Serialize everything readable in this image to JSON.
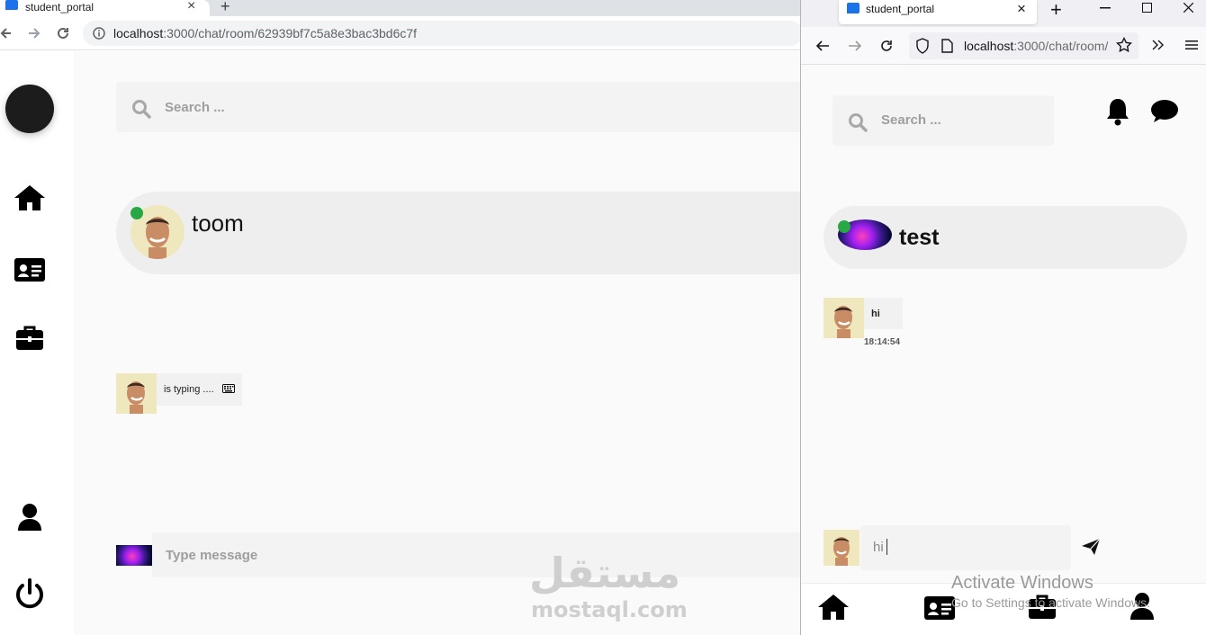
{
  "left_browser": {
    "tab_title": "student_portal",
    "tab_close": "×",
    "new_tab": "+",
    "url_host": "localhost",
    "url_path": ":3000/chat/room/62939bf7c5a8e3bac3bd6c7f"
  },
  "left_app": {
    "search_placeholder": "Search ...",
    "chat_contact_name": "toom",
    "typing_text": "is typing ....",
    "message_placeholder": "Type message"
  },
  "right_browser": {
    "tab_title": "student_portal",
    "tab_close": "×",
    "new_tab": "+",
    "url_host": "localhost",
    "url_path": ":3000/chat/room/"
  },
  "right_app": {
    "search_placeholder": "Search ...",
    "chat_contact_name": "test",
    "message_text": "hi",
    "message_time": "18:14:54",
    "message_input_value": "hi"
  },
  "overlays": {
    "watermark_arabic": "مستقل",
    "watermark_latin": "mostaql.com",
    "activate_title": "Activate Windows",
    "activate_subtitle": "Go to Settings to activate Windows."
  },
  "colors": {
    "online": "#27a845",
    "accent_tab_icon": "#1a73e8"
  },
  "icons": [
    "home-icon",
    "id-card-icon",
    "briefcase-icon",
    "user-icon",
    "power-icon",
    "search-icon",
    "bell-icon",
    "chat-bubble-icon",
    "send-icon",
    "keyboard-icon"
  ]
}
